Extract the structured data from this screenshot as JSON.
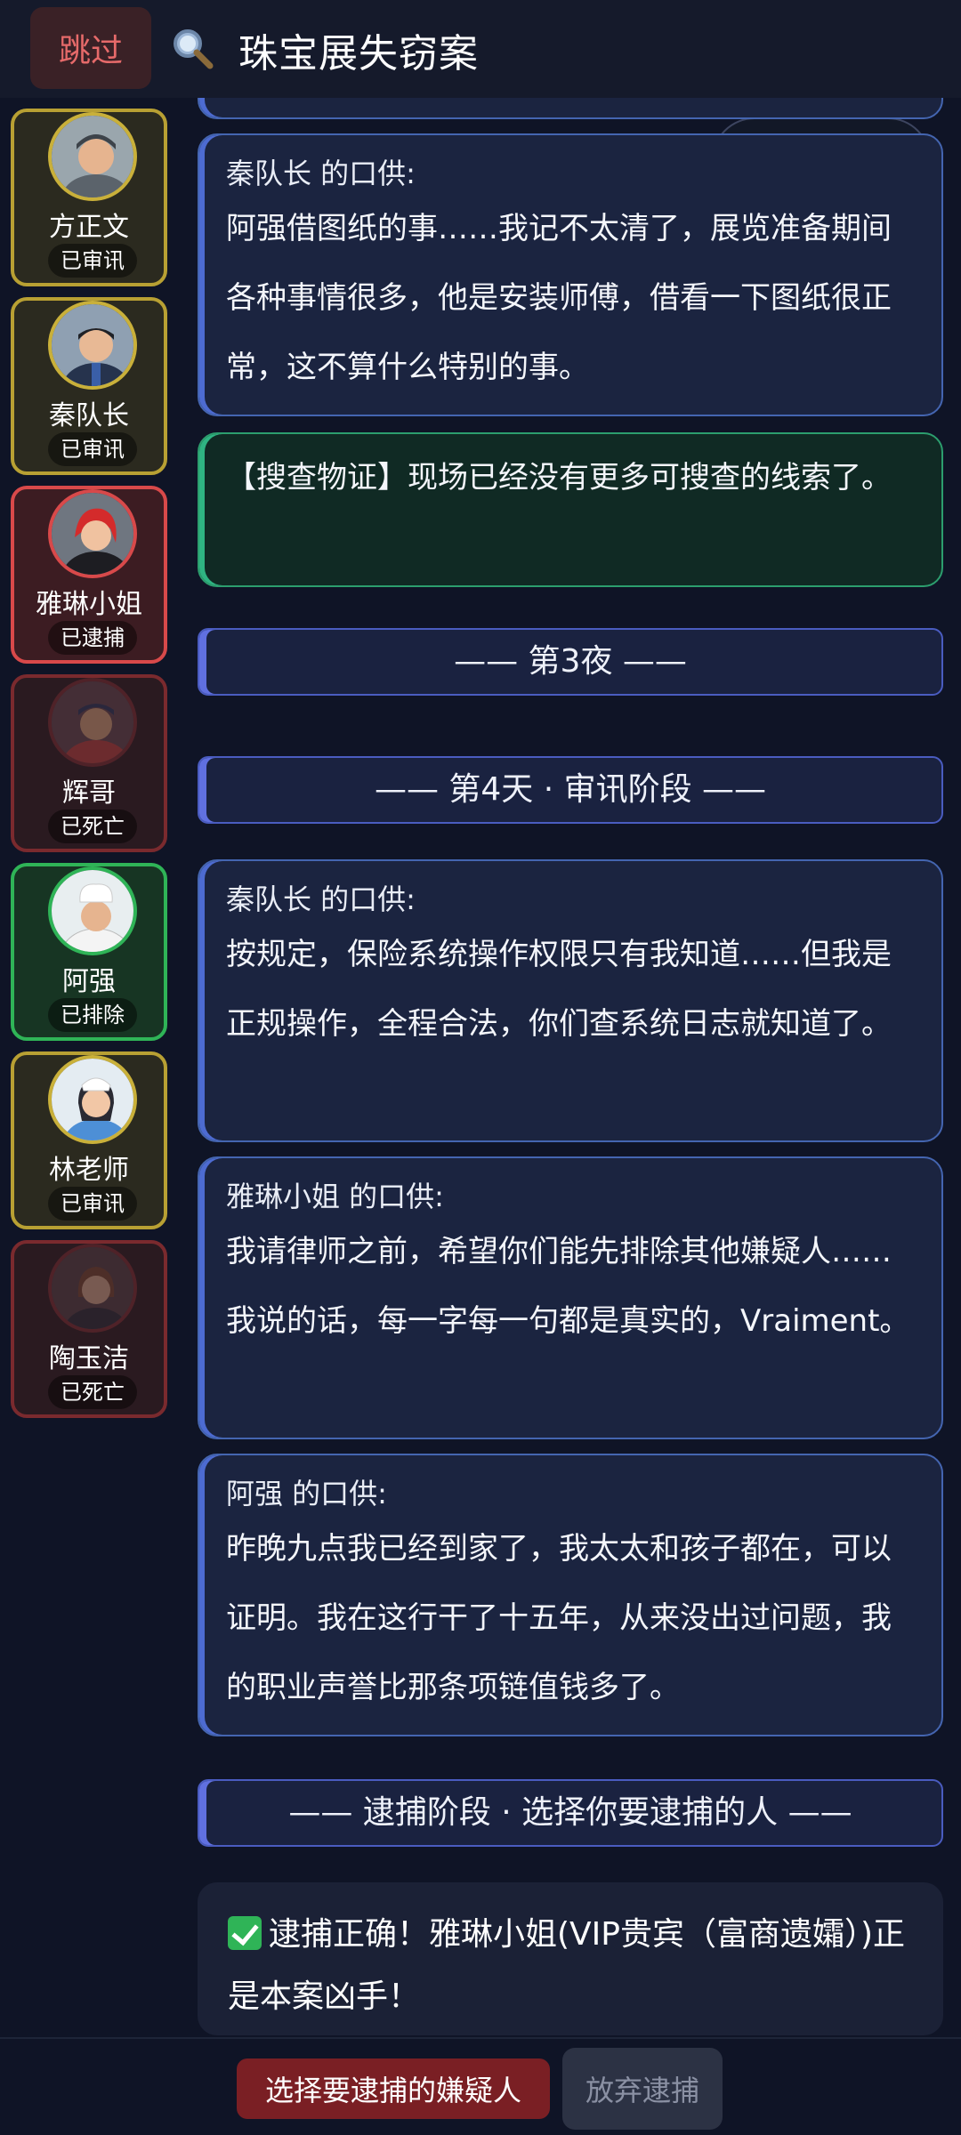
{
  "header": {
    "skip_label": "跳过",
    "title": "珠宝展失窃案"
  },
  "suspects": [
    {
      "name": "方正文",
      "status": "已审讯",
      "state": "interrogated"
    },
    {
      "name": "秦队长",
      "status": "已审讯",
      "state": "interrogated"
    },
    {
      "name": "雅琳小姐",
      "status": "已逮捕",
      "state": "arrested"
    },
    {
      "name": "辉哥",
      "status": "已死亡",
      "state": "dead"
    },
    {
      "name": "阿强",
      "status": "已排除",
      "state": "excluded"
    },
    {
      "name": "林老师",
      "status": "已审讯",
      "state": "interrogated"
    },
    {
      "name": "陶玉洁",
      "status": "已死亡",
      "state": "dead"
    }
  ],
  "log": {
    "card1": {
      "speaker": "秦队长 的口供:",
      "text": "阿强借图纸的事……我记不太清了，展览准备期间各种事情很多，他是安装师傅，借看一下图纸很正常，这不算什么特别的事。"
    },
    "evidence": {
      "text": "【搜查物证】现场已经没有更多可搜查的线索了。"
    },
    "phase_night3": "—— 第3夜 ——",
    "phase_day4": "—— 第4天 · 审讯阶段 ——",
    "card2": {
      "speaker": "秦队长 的口供:",
      "text": "按规定，保险系统操作权限只有我知道……但我是正规操作，全程合法，你们查系统日志就知道了。"
    },
    "card3": {
      "speaker": "雅琳小姐 的口供:",
      "text": "我请律师之前，希望你们能先排除其他嫌疑人……我说的话，每一字每一句都是真实的，Vraiment。"
    },
    "card4": {
      "speaker": "阿强 的口供:",
      "text": "昨晚九点我已经到家了，我太太和孩子都在，可以证明。我在这行干了十五年，从来没出过问题，我的职业声誉比那条项链值钱多了。"
    },
    "phase_arrest": "—— 逮捕阶段 · 选择你要逮捕的人 ——",
    "result": "逮捕正确！雅琳小姐(VIP贵宾（富商遗孀）)正是本案凶手！"
  },
  "footer": {
    "arrest_label": "选择要逮捕的嫌疑人",
    "giveup_label": "放弃逮捕"
  },
  "colors": {
    "interrogated": "#b8a033",
    "arrested": "#d8494a",
    "dead": "#7a2a2e",
    "excluded": "#2fb457"
  }
}
